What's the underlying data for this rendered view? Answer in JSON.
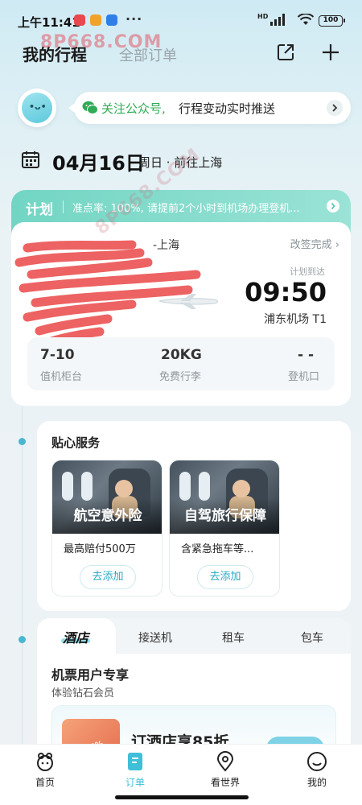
{
  "status_bar": {
    "time": "上午11:41",
    "hd": "HD",
    "battery": "100"
  },
  "header": {
    "tab_mine": "我的行程",
    "tab_all": "全部订单"
  },
  "follow_banner": {
    "highlight": "关注公众号,",
    "text": "行程变动实时推送"
  },
  "trip_date": {
    "date": "04月16日",
    "detail": "周日 · 前往上海"
  },
  "plan_card": {
    "label": "计划",
    "notice": "准点率: 100%, 请提前2个小时到机场办理登机...",
    "from_city": "-上海",
    "change_status": "改签完成 ›",
    "arrive_label": "计划到达",
    "arrive_time": "09:50",
    "arrive_airport": "浦东机场  T1",
    "info": [
      {
        "value": "7-10",
        "label": "值机柜台"
      },
      {
        "value": "20KG",
        "label": "免费行李"
      },
      {
        "value": "- -",
        "label": "登机口"
      }
    ]
  },
  "services": {
    "title": "贴心服务",
    "items": [
      {
        "name": "航空意外险",
        "desc": "最高赔付500万",
        "action": "去添加"
      },
      {
        "name": "自驾旅行保障",
        "desc": "含紧急拖车等...",
        "action": "去添加"
      }
    ]
  },
  "hotel": {
    "tabs": [
      "酒店",
      "接送机",
      "租车",
      "包车"
    ],
    "promo_title": "机票用户专享",
    "promo_sub": "体验钻石会员",
    "offer_tag": "-15%",
    "offer_text": "订酒店享85折"
  },
  "bottom_nav": [
    {
      "label": "首页",
      "icon": "home-icon"
    },
    {
      "label": "订单",
      "icon": "order-icon"
    },
    {
      "label": "看世界",
      "icon": "location-icon"
    },
    {
      "label": "我的",
      "icon": "profile-icon"
    }
  ],
  "watermark": {
    "top": "8P668.COM",
    "diag": "8P668.COM"
  },
  "colors": {
    "accent": "#2aa9c4",
    "plan_header": "#72d5c3",
    "wechat_green": "#2faa55",
    "nav_active": "#3fbfd8"
  }
}
